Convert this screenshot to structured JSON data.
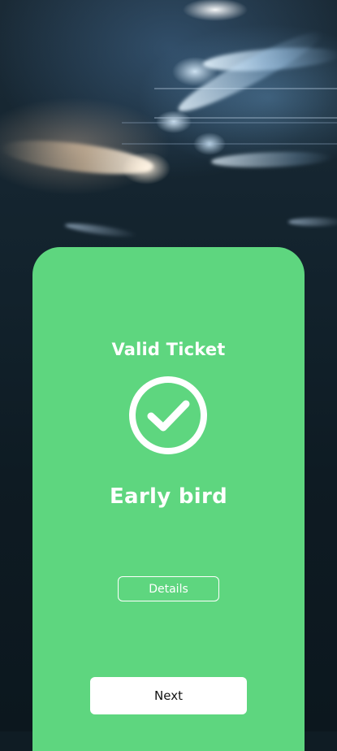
{
  "ticket": {
    "status_label": "Valid Ticket",
    "status_icon": "checkmark-circle-icon",
    "ticket_type": "Early bird",
    "details_label": "Details",
    "next_label": "Next"
  },
  "colors": {
    "card_background": "#5ed67f",
    "text": "#ffffff",
    "next_button_background": "#ffffff",
    "next_button_text": "#111111"
  }
}
